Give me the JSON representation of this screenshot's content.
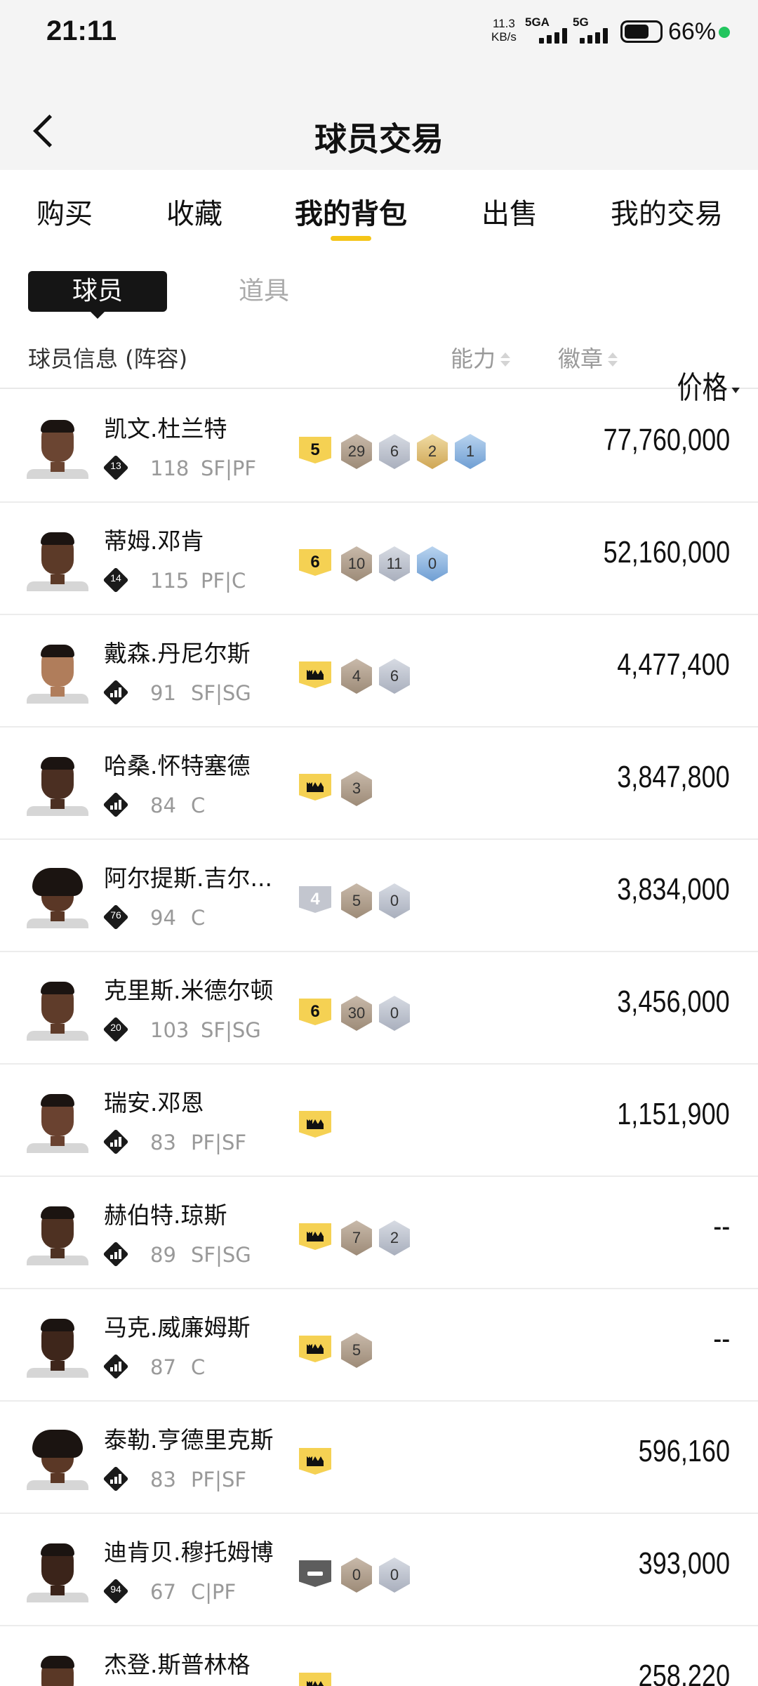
{
  "status_bar": {
    "time": "21:11",
    "net_speed_value": "11.3",
    "net_speed_unit": "KB/s",
    "signal1_label": "5GA",
    "signal2_label": "5G",
    "battery_percent": "66%"
  },
  "header": {
    "title": "球员交易"
  },
  "tabs": [
    {
      "label": "购买"
    },
    {
      "label": "收藏"
    },
    {
      "label": "我的背包",
      "active": true
    },
    {
      "label": "出售"
    },
    {
      "label": "我的交易"
    }
  ],
  "subtabs": {
    "players": "球员",
    "items": "道具"
  },
  "columns": {
    "info": "球员信息 (阵容)",
    "ability": "能力",
    "badge": "徽章",
    "price": "价格"
  },
  "players": [
    {
      "name": "凯文.杜兰特",
      "tag": "13",
      "ovr": "118",
      "pos": "SF|PF",
      "level": {
        "type": "gold",
        "text": "5"
      },
      "badges": [
        {
          "t": "bronze",
          "v": "29"
        },
        {
          "t": "silver",
          "v": "6"
        },
        {
          "t": "gold",
          "v": "2"
        },
        {
          "t": "hof",
          "v": "1"
        }
      ],
      "price": "77,760,000",
      "skin": "#6b4532"
    },
    {
      "name": "蒂姆.邓肯",
      "tag": "14",
      "ovr": "115",
      "pos": "PF|C",
      "level": {
        "type": "gold",
        "text": "6"
      },
      "badges": [
        {
          "t": "bronze",
          "v": "10"
        },
        {
          "t": "silver",
          "v": "11"
        },
        {
          "t": "hof",
          "v": "0"
        }
      ],
      "price": "52,160,000",
      "skin": "#5c3a28"
    },
    {
      "name": "戴森.丹尼尔斯",
      "tag": "bars",
      "ovr": "91",
      "pos": "SF|SG",
      "level": {
        "type": "gold",
        "text": "crown"
      },
      "badges": [
        {
          "t": "bronze",
          "v": "4"
        },
        {
          "t": "silver",
          "v": "6"
        }
      ],
      "price": "4,477,400",
      "skin": "#b07d5b"
    },
    {
      "name": "哈桑.怀特塞德",
      "tag": "bars",
      "ovr": "84",
      "pos": "C",
      "level": {
        "type": "gold",
        "text": "crown"
      },
      "badges": [
        {
          "t": "bronze",
          "v": "3"
        }
      ],
      "price": "3,847,800",
      "skin": "#4b2f22"
    },
    {
      "name": "阿尔提斯.吉尔...",
      "tag": "76",
      "ovr": "94",
      "pos": "C",
      "level": {
        "type": "silver",
        "text": "4"
      },
      "badges": [
        {
          "t": "bronze",
          "v": "5"
        },
        {
          "t": "silver",
          "v": "0"
        }
      ],
      "price": "3,834,000",
      "skin": "#5a3726",
      "afro": true
    },
    {
      "name": "克里斯.米德尔顿",
      "tag": "20",
      "ovr": "103",
      "pos": "SF|SG",
      "level": {
        "type": "gold",
        "text": "6"
      },
      "badges": [
        {
          "t": "bronze",
          "v": "30"
        },
        {
          "t": "silver",
          "v": "0"
        }
      ],
      "price": "3,456,000",
      "skin": "#5f3c2a"
    },
    {
      "name": "瑞安.邓恩",
      "tag": "bars",
      "ovr": "83",
      "pos": "PF|SF",
      "level": {
        "type": "gold",
        "text": "crown"
      },
      "badges": [],
      "price": "1,151,900",
      "skin": "#6a4230"
    },
    {
      "name": "赫伯特.琼斯",
      "tag": "bars",
      "ovr": "89",
      "pos": "SF|SG",
      "level": {
        "type": "gold",
        "text": "crown"
      },
      "badges": [
        {
          "t": "bronze",
          "v": "7"
        },
        {
          "t": "silver",
          "v": "2"
        }
      ],
      "price": "--",
      "skin": "#4e3122"
    },
    {
      "name": "马克.威廉姆斯",
      "tag": "bars",
      "ovr": "87",
      "pos": "C",
      "level": {
        "type": "gold",
        "text": "crown"
      },
      "badges": [
        {
          "t": "bronze",
          "v": "5"
        }
      ],
      "price": "--",
      "skin": "#3e261b"
    },
    {
      "name": "泰勒.亨德里克斯",
      "tag": "bars",
      "ovr": "83",
      "pos": "PF|SF",
      "level": {
        "type": "gold",
        "text": "crown"
      },
      "badges": [],
      "price": "596,160",
      "skin": "#5b3826",
      "afro": true
    },
    {
      "name": "迪肯贝.穆托姆博",
      "tag": "94",
      "ovr": "67",
      "pos": "C|PF",
      "level": {
        "type": "dark",
        "text": "dash"
      },
      "badges": [
        {
          "t": "bronze",
          "v": "0"
        },
        {
          "t": "silver",
          "v": "0"
        }
      ],
      "price": "393,000",
      "skin": "#3b241a"
    },
    {
      "name": "杰登.斯普林格",
      "tag": "bars",
      "ovr": "",
      "pos": "",
      "level": {
        "type": "gold",
        "text": "crown"
      },
      "badges": [],
      "price": "258,220",
      "skin": "#5a3826"
    }
  ]
}
